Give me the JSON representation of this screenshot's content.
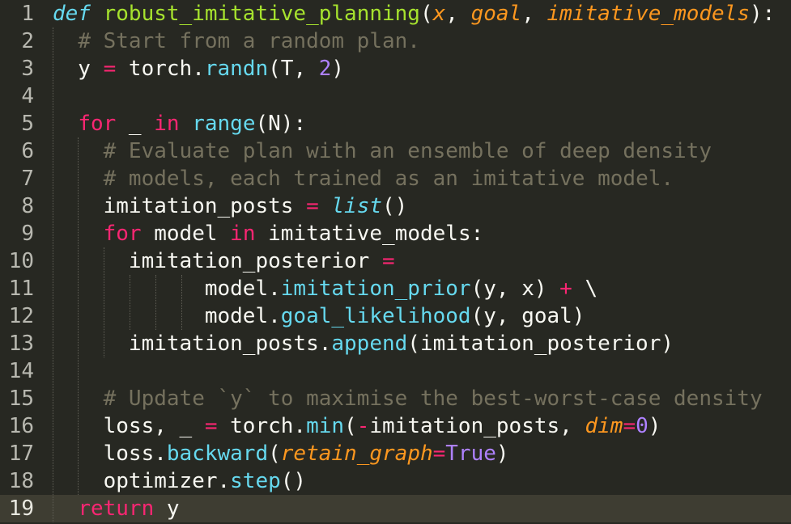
{
  "editor": {
    "lines": [
      {
        "number": "1",
        "tokens": [
          {
            "t": "def",
            "k": "def"
          },
          {
            "t": " ",
            "k": "text"
          },
          {
            "t": "robust_imitative_planning",
            "k": "fn"
          },
          {
            "t": "(",
            "k": "text"
          },
          {
            "t": "x",
            "k": "param"
          },
          {
            "t": ", ",
            "k": "text"
          },
          {
            "t": "goal",
            "k": "param"
          },
          {
            "t": ", ",
            "k": "text"
          },
          {
            "t": "imitative_models",
            "k": "param"
          },
          {
            "t": "):",
            "k": "text"
          }
        ]
      },
      {
        "number": "2",
        "tokens": [
          {
            "t": "  ",
            "k": "text"
          },
          {
            "t": "# Start from a random plan.",
            "k": "comment"
          }
        ]
      },
      {
        "number": "3",
        "tokens": [
          {
            "t": "  y ",
            "k": "text"
          },
          {
            "t": "=",
            "k": "op"
          },
          {
            "t": " torch.",
            "k": "text"
          },
          {
            "t": "randn",
            "k": "call"
          },
          {
            "t": "(T, ",
            "k": "text"
          },
          {
            "t": "2",
            "k": "num"
          },
          {
            "t": ")",
            "k": "text"
          }
        ]
      },
      {
        "number": "4",
        "tokens": []
      },
      {
        "number": "5",
        "tokens": [
          {
            "t": "  ",
            "k": "text"
          },
          {
            "t": "for",
            "k": "kw"
          },
          {
            "t": " _ ",
            "k": "text"
          },
          {
            "t": "in",
            "k": "kw"
          },
          {
            "t": " ",
            "k": "text"
          },
          {
            "t": "range",
            "k": "call"
          },
          {
            "t": "(N):",
            "k": "text"
          }
        ]
      },
      {
        "number": "6",
        "tokens": [
          {
            "t": "    ",
            "k": "text"
          },
          {
            "t": "# Evaluate plan with an ensemble of deep density",
            "k": "comment"
          }
        ]
      },
      {
        "number": "7",
        "tokens": [
          {
            "t": "    ",
            "k": "text"
          },
          {
            "t": "# models, each trained as an imitative model.",
            "k": "comment"
          }
        ]
      },
      {
        "number": "8",
        "tokens": [
          {
            "t": "    imitation_posts ",
            "k": "text"
          },
          {
            "t": "=",
            "k": "op"
          },
          {
            "t": " ",
            "k": "text"
          },
          {
            "t": "list",
            "k": "builtin"
          },
          {
            "t": "()",
            "k": "text"
          }
        ]
      },
      {
        "number": "9",
        "tokens": [
          {
            "t": "    ",
            "k": "text"
          },
          {
            "t": "for",
            "k": "kw"
          },
          {
            "t": " model ",
            "k": "text"
          },
          {
            "t": "in",
            "k": "kw"
          },
          {
            "t": " imitative_models:",
            "k": "text"
          }
        ]
      },
      {
        "number": "10",
        "tokens": [
          {
            "t": "      imitation_posterior ",
            "k": "text"
          },
          {
            "t": "=",
            "k": "op"
          }
        ]
      },
      {
        "number": "11",
        "tokens": [
          {
            "t": "            model.",
            "k": "text"
          },
          {
            "t": "imitation_prior",
            "k": "call"
          },
          {
            "t": "(y, x) ",
            "k": "text"
          },
          {
            "t": "+",
            "k": "op"
          },
          {
            "t": " \\",
            "k": "text"
          }
        ]
      },
      {
        "number": "12",
        "tokens": [
          {
            "t": "            model.",
            "k": "text"
          },
          {
            "t": "goal_likelihood",
            "k": "call"
          },
          {
            "t": "(y, goal)",
            "k": "text"
          }
        ]
      },
      {
        "number": "13",
        "tokens": [
          {
            "t": "      imitation_posts.",
            "k": "text"
          },
          {
            "t": "append",
            "k": "call"
          },
          {
            "t": "(imitation_posterior)",
            "k": "text"
          }
        ]
      },
      {
        "number": "14",
        "tokens": []
      },
      {
        "number": "15",
        "tokens": [
          {
            "t": "    ",
            "k": "text"
          },
          {
            "t": "# Update `y` to maximise the best-worst-case density",
            "k": "comment"
          }
        ]
      },
      {
        "number": "16",
        "tokens": [
          {
            "t": "    loss, _ ",
            "k": "text"
          },
          {
            "t": "=",
            "k": "op"
          },
          {
            "t": " torch.",
            "k": "text"
          },
          {
            "t": "min",
            "k": "call"
          },
          {
            "t": "(",
            "k": "text"
          },
          {
            "t": "-",
            "k": "op"
          },
          {
            "t": "imitation_posts, ",
            "k": "text"
          },
          {
            "t": "dim",
            "k": "kwarg"
          },
          {
            "t": "=",
            "k": "op"
          },
          {
            "t": "0",
            "k": "num"
          },
          {
            "t": ")",
            "k": "text"
          }
        ]
      },
      {
        "number": "17",
        "tokens": [
          {
            "t": "    loss.",
            "k": "text"
          },
          {
            "t": "backward",
            "k": "call"
          },
          {
            "t": "(",
            "k": "text"
          },
          {
            "t": "retain_graph",
            "k": "kwarg"
          },
          {
            "t": "=",
            "k": "op"
          },
          {
            "t": "True",
            "k": "const"
          },
          {
            "t": ")",
            "k": "text"
          }
        ]
      },
      {
        "number": "18",
        "tokens": [
          {
            "t": "    optimizer.",
            "k": "text"
          },
          {
            "t": "step",
            "k": "call"
          },
          {
            "t": "()",
            "k": "text"
          }
        ]
      },
      {
        "number": "19",
        "current": true,
        "tokens": [
          {
            "t": "  ",
            "k": "text"
          },
          {
            "t": "return",
            "k": "kw"
          },
          {
            "t": " y",
            "k": "text"
          }
        ]
      }
    ]
  },
  "theme": {
    "background": "#272822",
    "current_line": "#3e3d32",
    "keyword": "#f92672",
    "function_name": "#a6e22e",
    "parameter": "#fd971f",
    "call": "#66d9ef",
    "number": "#ae81ff",
    "comment": "#75715e",
    "text": "#f8f8f2"
  }
}
